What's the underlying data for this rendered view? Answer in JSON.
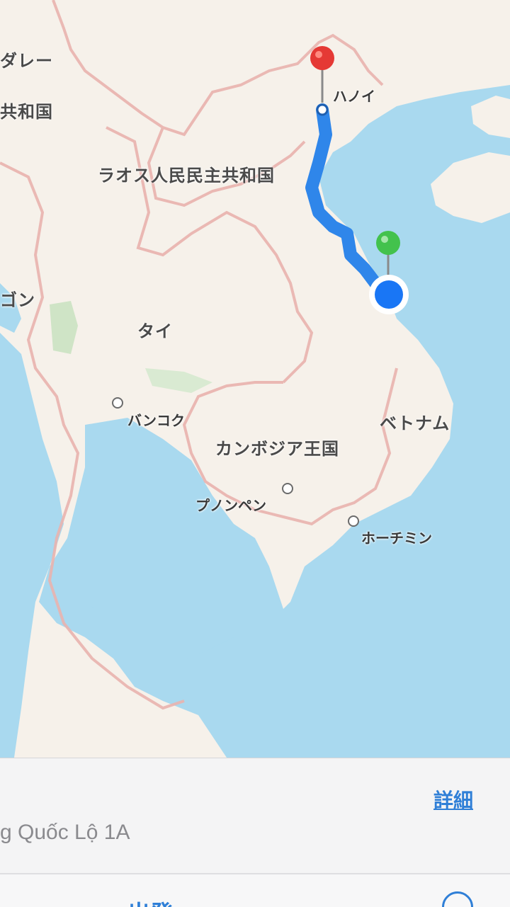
{
  "map": {
    "labels": {
      "myanmar_fragment": "ダレー",
      "myanmar_fragment2": "共和国",
      "laos": "ラオス人民民主共和国",
      "thailand": "タイ",
      "rangoon_fragment": "ゴン",
      "cambodia": "カンボジア王国",
      "vietnam": "ベトナム",
      "hanoi": "ハノイ",
      "bangkok": "バンコク",
      "phnompenh": "プノンペン",
      "hochiminh": "ホーチミン"
    },
    "colors": {
      "water": "#a9d9ef",
      "land": "#f6f1ea",
      "border": "#e9b2ae",
      "route": "#2f86ea",
      "destination_pin": "#e53935",
      "start_pin": "#43c24d",
      "current_location": "#1976f5"
    }
  },
  "sheet": {
    "road": "g Quốc Lộ 1A",
    "detail": "詳細",
    "start": "出発"
  }
}
